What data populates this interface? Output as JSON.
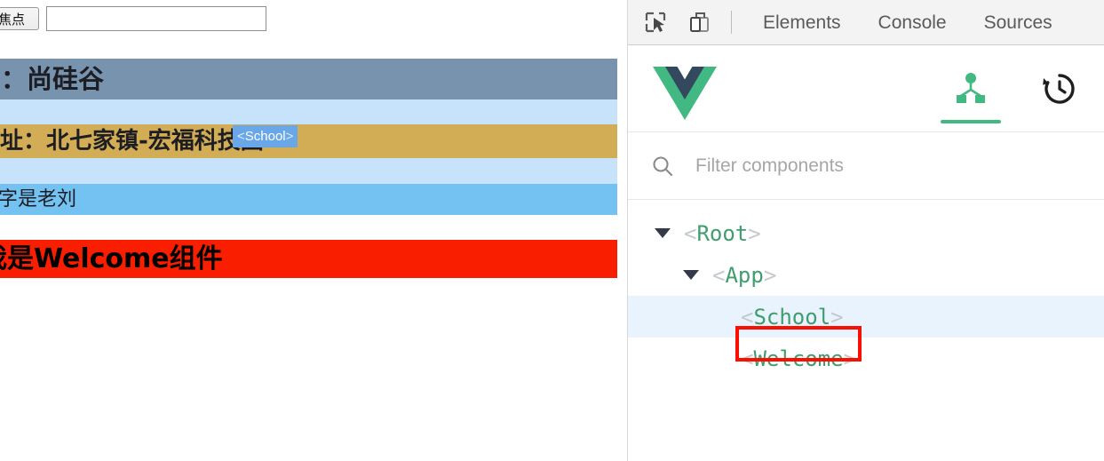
{
  "app": {
    "focus": {
      "button_label": "焦点",
      "input_value": "",
      "input_placeholder": ""
    },
    "bands": [
      {
        "id": "school-name",
        "text": "名：尚硅谷",
        "color": "#7793ad"
      },
      {
        "id": "gap-1",
        "text": "",
        "color": "#c7e3fb"
      },
      {
        "id": "school-address",
        "text": "地址：北七家镇-宏福科技园",
        "color": "#d2ad55"
      },
      {
        "id": "gap-2",
        "text": "",
        "color": "#c7e3fb"
      },
      {
        "id": "student-name",
        "text": "名字是老刘",
        "color": "#74c2f2"
      },
      {
        "id": "gap-3",
        "text": "",
        "color": "#ffffff"
      },
      {
        "id": "welcome",
        "text": "我是Welcome组件",
        "color": "#fa1e00"
      }
    ],
    "highlight_badge": {
      "open_bracket": "<",
      "name": "School",
      "close_bracket": ">",
      "color": "#69a7e8"
    }
  },
  "devtools": {
    "toolbar": {
      "inspect_icon": "inspect-element-icon",
      "device_icon": "device-toolbar-icon",
      "tabs": [
        {
          "id": "elements",
          "label": "Elements",
          "active": false
        },
        {
          "id": "console",
          "label": "Console",
          "active": false
        },
        {
          "id": "sources",
          "label": "Sources",
          "active": false
        }
      ]
    },
    "vue_panel": {
      "logo": "vue-logo-icon",
      "accent_color": "#42b883",
      "tabs": [
        {
          "id": "components",
          "icon": "component-tree-icon",
          "active": true
        },
        {
          "id": "timeline",
          "icon": "history-clock-icon",
          "active": false
        }
      ],
      "filter": {
        "icon": "search-icon",
        "value": "",
        "placeholder": "Filter components"
      },
      "tree": [
        {
          "id": "root",
          "name": "Root",
          "depth": 0,
          "caret": true,
          "selected": false
        },
        {
          "id": "app",
          "name": "App",
          "depth": 1,
          "caret": true,
          "selected": false
        },
        {
          "id": "school",
          "name": "School",
          "depth": 2,
          "caret": false,
          "selected": true
        },
        {
          "id": "welcome",
          "name": "Welcome",
          "depth": 2,
          "caret": false,
          "selected": false
        }
      ],
      "bracket_open": "<",
      "bracket_close": ">"
    },
    "annotation": {
      "target": "School",
      "color": "#fb0f00"
    }
  }
}
